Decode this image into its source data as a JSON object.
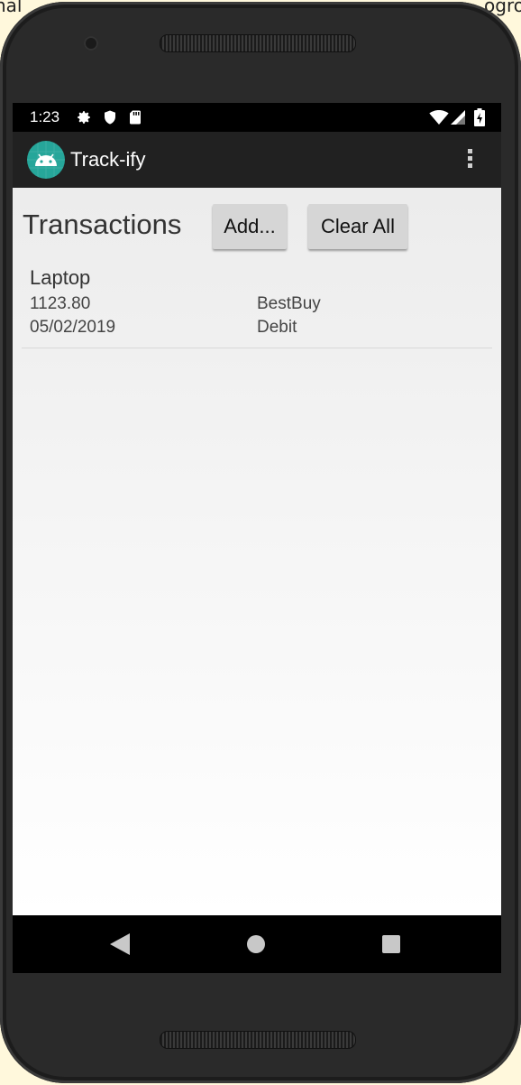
{
  "background_fragments": {
    "left": "nal",
    "right": "ogro"
  },
  "status_bar": {
    "time": "1:23",
    "left_icons": [
      "gear-icon",
      "shield-icon",
      "sd-card-icon"
    ],
    "right_icons": [
      "wifi-icon",
      "signal-icon",
      "battery-icon"
    ]
  },
  "app_bar": {
    "title": "Track-ify",
    "logo_icon": "android-icon",
    "menu_icon": "more-vert-icon",
    "background": "#212121",
    "logo_color": "#26a69a"
  },
  "main": {
    "heading": "Transactions",
    "add_button_label": "Add...",
    "clear_button_label": "Clear All"
  },
  "transactions": [
    {
      "name": "Laptop",
      "amount": "1123.80",
      "date": "05/02/2019",
      "vendor": "BestBuy",
      "type": "Debit"
    }
  ],
  "nav_bar": {
    "back_icon": "back-triangle-icon",
    "home_icon": "home-circle-icon",
    "recents_icon": "recents-square-icon"
  }
}
